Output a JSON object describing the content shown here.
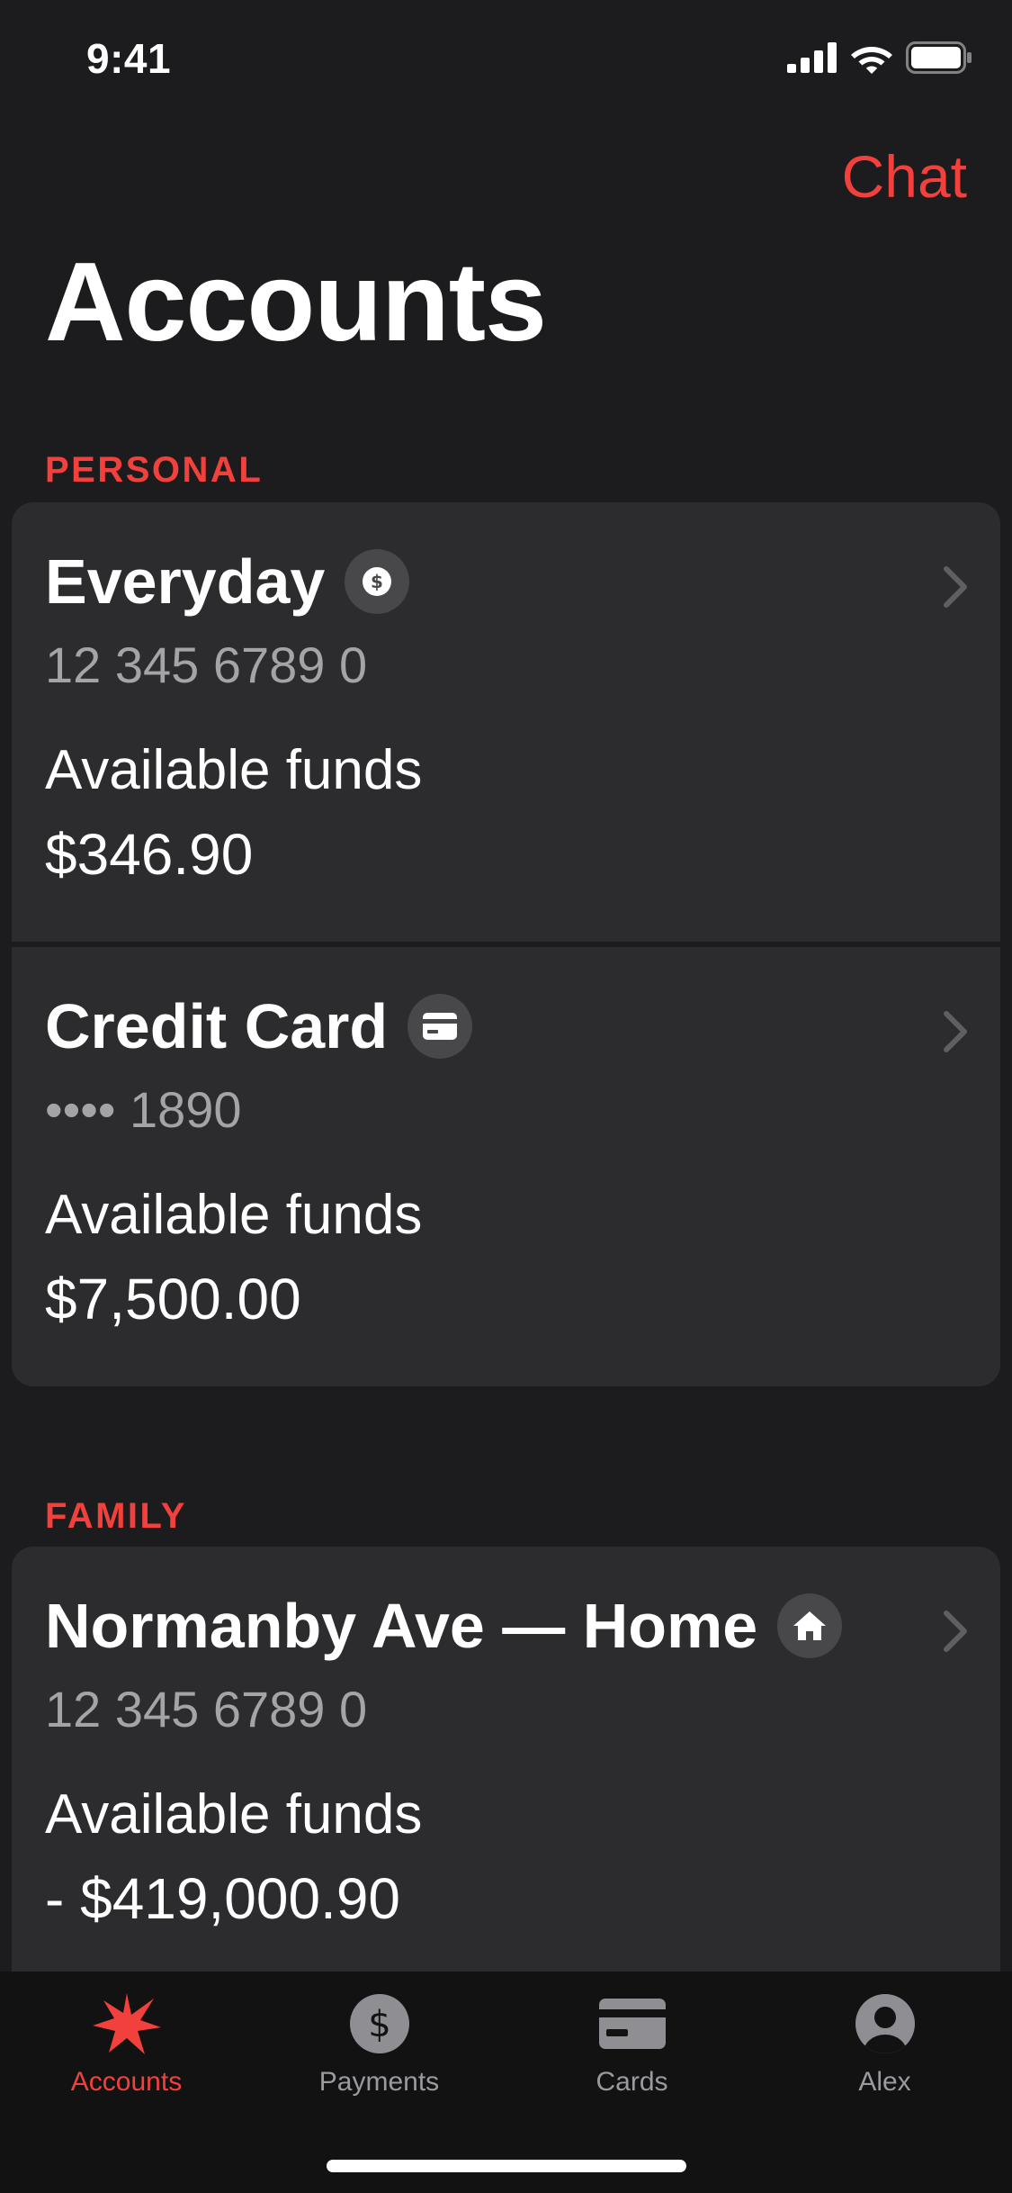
{
  "status_bar": {
    "time": "9:41"
  },
  "header": {
    "chat_label": "Chat",
    "title": "Accounts"
  },
  "sections": [
    {
      "title": "PERSONAL",
      "accounts": [
        {
          "name": "Everyday",
          "icon": "dollar-icon",
          "number": "12 345 6789 0",
          "funds_label": "Available funds",
          "funds_value": "$346.90"
        },
        {
          "name": "Credit Card",
          "icon": "credit-card-icon",
          "number": "•••• 1890",
          "funds_label": "Available funds",
          "funds_value": "$7,500.00"
        }
      ]
    },
    {
      "title": "FAMILY",
      "accounts": [
        {
          "name": "Normanby Ave — Home",
          "icon": "home-icon",
          "number": "12 345 6789 0",
          "funds_label": "Available funds",
          "funds_value": "- $419,000.90"
        }
      ]
    }
  ],
  "tab_bar": {
    "tabs": [
      {
        "label": "Accounts",
        "icon": "star-logo-icon",
        "active": true
      },
      {
        "label": "Payments",
        "icon": "dollar-circle-icon",
        "active": false
      },
      {
        "label": "Cards",
        "icon": "card-icon",
        "active": false
      },
      {
        "label": "Alex",
        "icon": "person-icon",
        "active": false
      }
    ]
  },
  "colors": {
    "accent": "#f2413d",
    "background": "#1c1c1e",
    "card": "#2c2c2e",
    "tab_bar": "#121212",
    "secondary_text": "#a3a3a8"
  }
}
